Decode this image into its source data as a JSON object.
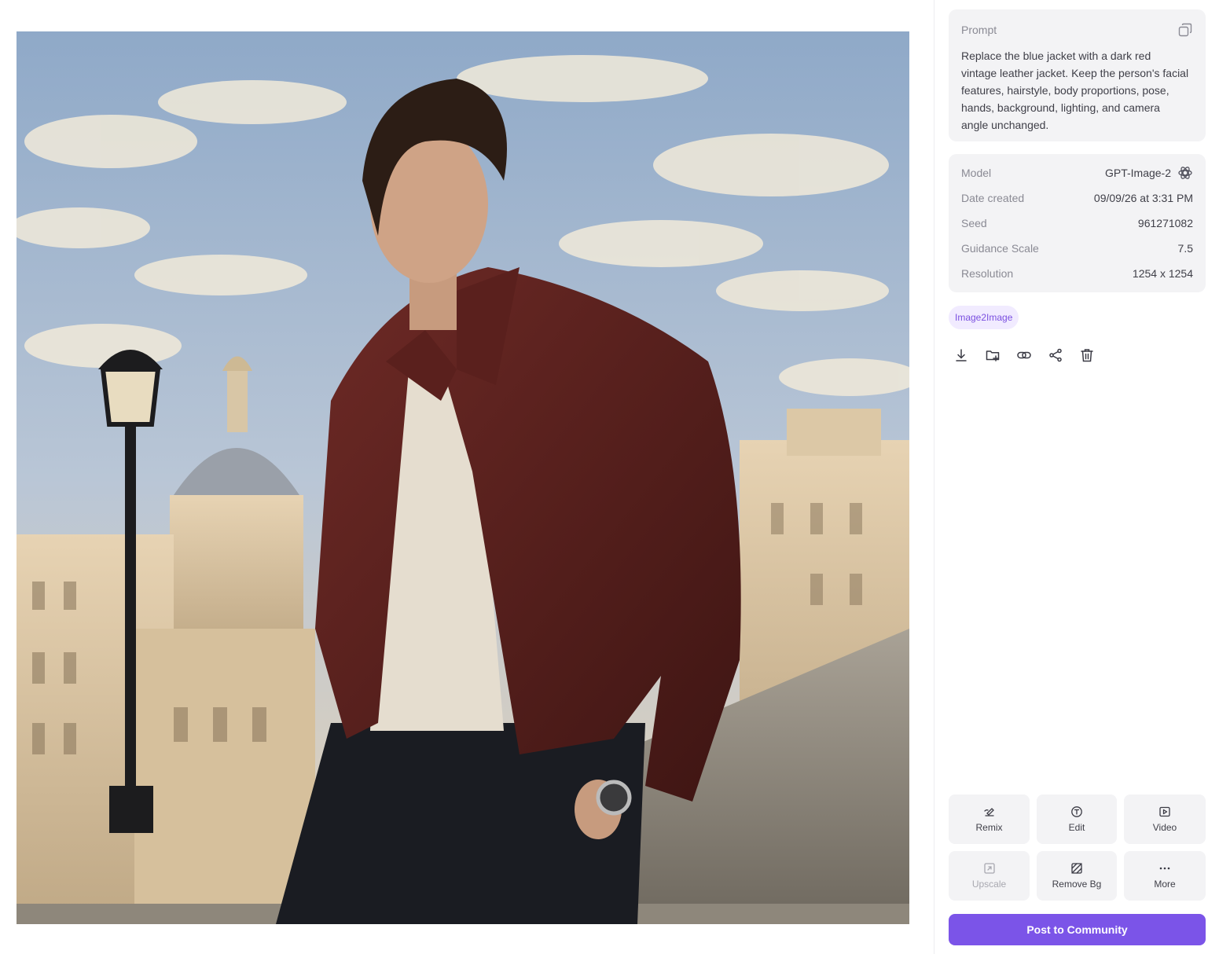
{
  "prompt": {
    "label": "Prompt",
    "text": "Replace the blue jacket with a dark red vintage leather jacket. Keep the person's facial features, hairstyle, body proportions, pose, hands, background, lighting, and camera angle unchanged.",
    "copy_icon": "copy-icon"
  },
  "meta": {
    "model_label": "Model",
    "model_value": "GPT-Image-2",
    "model_icon": "openai-logo-icon",
    "date_label": "Date created",
    "date_value": "09/09/26 at 3:31 PM",
    "seed_label": "Seed",
    "seed_value": "961271082",
    "guidance_label": "Guidance Scale",
    "guidance_value": "7.5",
    "resolution_label": "Resolution",
    "resolution_value": "1254 x 1254"
  },
  "tag": "Image2Image",
  "actions": [
    "download-icon",
    "add-to-folder-icon",
    "link-icon",
    "share-icon",
    "trash-icon"
  ],
  "tools": {
    "remix": "Remix",
    "edit": "Edit",
    "video": "Video",
    "upscale": "Upscale",
    "remove_bg": "Remove Bg",
    "more": "More"
  },
  "post_button": "Post to Community",
  "colors": {
    "accent": "#7b54e8",
    "tag_bg": "#f1ebff",
    "card_bg": "#f3f3f5"
  }
}
